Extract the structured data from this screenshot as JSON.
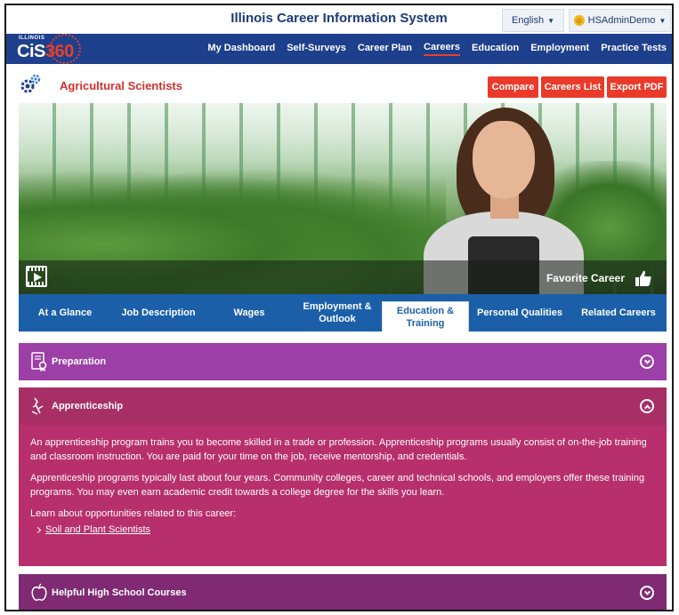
{
  "header": {
    "site_title": "Illinois Career Information System",
    "language": "English",
    "user": "HSAdminDemo"
  },
  "logo": {
    "state": "ILLINOIS",
    "brand_cis": "CiS",
    "brand_360": "360"
  },
  "nav": {
    "items": [
      "My Dashboard",
      "Self-Surveys",
      "Career Plan",
      "Careers",
      "Education",
      "Employment",
      "Practice Tests"
    ],
    "active": "Careers"
  },
  "career": {
    "title": "Agricultural Scientists",
    "compare_label": "Compare",
    "careers_list_label": "Careers List",
    "export_pdf_label": "Export PDF"
  },
  "hero": {
    "favorite_label": "Favorite Career"
  },
  "tabs": {
    "items": [
      {
        "label": "At a Glance",
        "line2": ""
      },
      {
        "label": "Job Description",
        "line2": ""
      },
      {
        "label": "Wages",
        "line2": ""
      },
      {
        "label": "Employment &",
        "line2": "Outlook"
      },
      {
        "label": "Education &",
        "line2": "Training"
      },
      {
        "label": "Personal Qualities",
        "line2": ""
      },
      {
        "label": "Related Careers",
        "line2": ""
      }
    ],
    "active_index": 4
  },
  "sections": {
    "preparation": {
      "title": "Preparation"
    },
    "apprenticeship": {
      "title": "Apprenticeship",
      "p1": "An apprenticeship program trains you to become skilled in a trade or profession. Apprenticeship programs usually consist of on-the-job training and classroom instruction. You are paid for your time on the job, receive mentorship, and credentials.",
      "p2": "Apprenticeship programs typically last about four years. Community colleges, career and technical schools, and employers offer these training programs. You may even earn academic credit towards a college degree for the skills you learn.",
      "p3": "Learn about opportunities related to this career:",
      "link": "Soil and Plant Scientists"
    },
    "high_school": {
      "title": "Helpful High School Courses"
    }
  },
  "colors": {
    "nav_blue": "#1d3f8c",
    "tab_blue": "#1b5fa8",
    "action_red": "#ea3a2a",
    "preparation_purple": "#9c3fa6",
    "apprenticeship_magenta": "#b72f6c",
    "high_school_plum": "#7f2a72"
  }
}
